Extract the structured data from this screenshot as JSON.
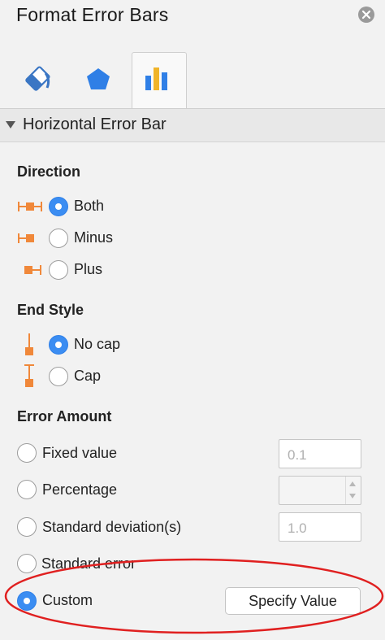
{
  "window": {
    "title": "Format Error Bars"
  },
  "tabs": [
    {
      "name": "fill-line",
      "icon": "paint-bucket-icon"
    },
    {
      "name": "effects",
      "icon": "pentagon-icon"
    },
    {
      "name": "options",
      "icon": "bar-chart-icon",
      "selected": true
    }
  ],
  "section": {
    "label": "Horizontal Error Bar"
  },
  "direction": {
    "heading": "Direction",
    "options": [
      {
        "label": "Both",
        "selected": true,
        "icon": "both-error-bar-icon"
      },
      {
        "label": "Minus",
        "selected": false,
        "icon": "minus-error-bar-icon"
      },
      {
        "label": "Plus",
        "selected": false,
        "icon": "plus-error-bar-icon"
      }
    ]
  },
  "end_style": {
    "heading": "End Style",
    "options": [
      {
        "label": "No cap",
        "selected": true,
        "icon": "no-cap-icon"
      },
      {
        "label": "Cap",
        "selected": false,
        "icon": "cap-icon"
      }
    ]
  },
  "error_amount": {
    "heading": "Error Amount",
    "fixed_value": {
      "label": "Fixed value",
      "value": "0.1",
      "selected": false
    },
    "percentage": {
      "label": "Percentage",
      "value": "",
      "selected": false
    },
    "std_dev": {
      "label": "Standard deviation(s)",
      "value": "1.0",
      "selected": false
    },
    "std_error": {
      "label": "Standard error",
      "selected": false
    },
    "custom": {
      "label": "Custom",
      "selected": true,
      "button_label": "Specify Value"
    }
  },
  "colors": {
    "accent": "#3b8df2",
    "icon_orange": "#f0883a",
    "annotation_red": "#e02020"
  }
}
